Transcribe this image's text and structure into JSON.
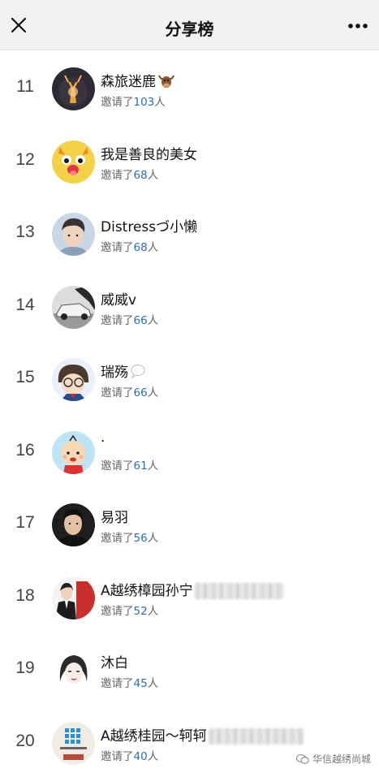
{
  "header": {
    "title": "分享榜",
    "close_icon": "close-icon",
    "more_icon": "more-dots-icon"
  },
  "invite_prefix": "邀请了",
  "invite_suffix": "人",
  "entries": [
    {
      "rank": "11",
      "name": "森旅迷鹿",
      "count": "103",
      "avatar": "deer-lamp-avatar",
      "emoji": "ox-emoji"
    },
    {
      "rank": "12",
      "name": "我是善良的美女",
      "count": "68",
      "avatar": "yellow-cartoon-avatar"
    },
    {
      "rank": "13",
      "name": "Distressづ小懒",
      "count": "68",
      "avatar": "young-man-avatar"
    },
    {
      "rank": "14",
      "name": "威威v",
      "count": "66",
      "avatar": "car-avatar"
    },
    {
      "rank": "15",
      "name": "瑞殇",
      "count": "66",
      "avatar": "detective-cartoon-avatar",
      "emoji": "speech-bubble-emoji"
    },
    {
      "rank": "16",
      "name": "·",
      "count": "61",
      "avatar": "cartoon-boy-avatar"
    },
    {
      "rank": "17",
      "name": "易羽",
      "count": "56",
      "avatar": "man-portrait-avatar"
    },
    {
      "rank": "18",
      "name": "A越绣樟园孙宁",
      "count": "52",
      "avatar": "agent-woman-avatar"
    },
    {
      "rank": "19",
      "name": "沐白",
      "count": "45",
      "avatar": "sketch-girl-avatar"
    },
    {
      "rank": "20",
      "name": "A越绣桂园～轲轲",
      "count": "40",
      "avatar": "company-logo-avatar"
    }
  ],
  "watermark": {
    "text": "华信越绣尚城",
    "icon": "wechat-icon"
  }
}
